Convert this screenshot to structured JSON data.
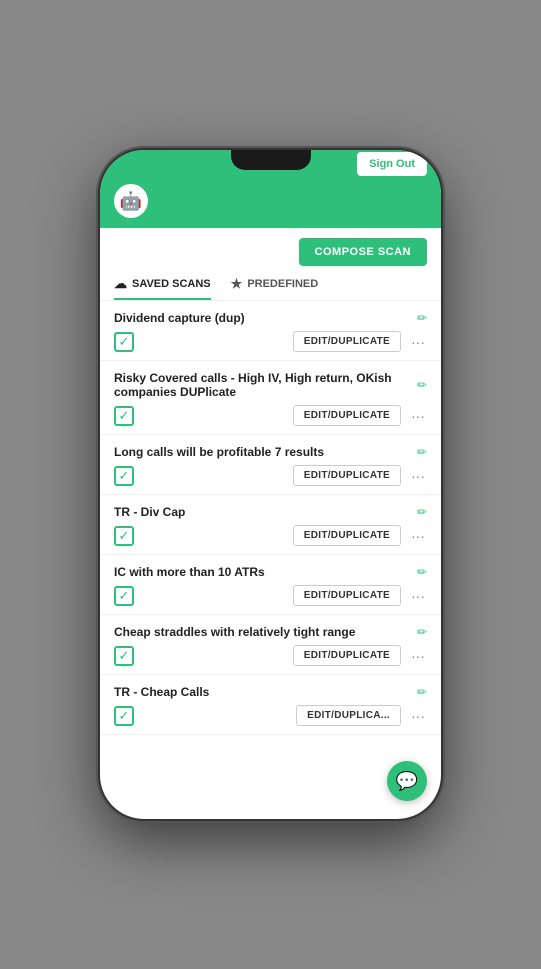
{
  "status_bar": {
    "sign_out_label": "Sign Out"
  },
  "header": {
    "logo_emoji": "🤖"
  },
  "compose_scan": {
    "label": "COMPOSE SCAN"
  },
  "tabs": [
    {
      "id": "saved",
      "icon": "☁",
      "label": "SAVED SCANS",
      "active": true
    },
    {
      "id": "predefined",
      "icon": "★",
      "label": "PREDEFINED",
      "active": false
    }
  ],
  "scans": [
    {
      "id": 1,
      "title": "Dividend capture (dup)",
      "checked": true,
      "edit_label": "EDIT/DUPLICATE"
    },
    {
      "id": 2,
      "title": "Risky Covered calls - High IV, High return, OKish companies DUPlicate",
      "checked": true,
      "edit_label": "EDIT/DUPLICATE"
    },
    {
      "id": 3,
      "title": "Long calls will be profitable 7 results",
      "checked": true,
      "edit_label": "EDIT/DUPLICATE"
    },
    {
      "id": 4,
      "title": "TR - Div Cap",
      "checked": true,
      "edit_label": "EDIT/DUPLICATE"
    },
    {
      "id": 5,
      "title": "IC with more than 10 ATRs",
      "checked": true,
      "edit_label": "EDIT/DUPLICATE"
    },
    {
      "id": 6,
      "title": "Cheap straddles with relatively tight range",
      "checked": true,
      "edit_label": "EDIT/DUPLICATE"
    },
    {
      "id": 7,
      "title": "TR - Cheap Calls",
      "checked": true,
      "edit_label": "EDIT/DUPLICA..."
    }
  ],
  "fab": {
    "icon": "💬"
  }
}
